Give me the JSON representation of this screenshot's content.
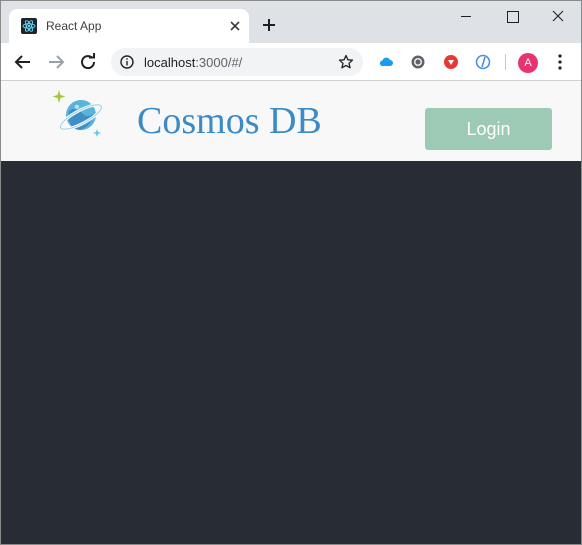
{
  "browser": {
    "tab": {
      "title": "React App"
    },
    "address": {
      "host": "localhost",
      "path": ":3000/#/"
    },
    "profile_initial": "A"
  },
  "app": {
    "brand": "Cosmos DB",
    "login_label": "Login"
  },
  "colors": {
    "header_bg": "#f8f8f8",
    "page_bg": "#282c34",
    "brand_text": "#3a8cc9",
    "login_bg": "#9ccab4",
    "avatar_bg": "#e8336e"
  },
  "icons": [
    "react-favicon-icon",
    "close-icon",
    "plus-icon",
    "back-arrow-icon",
    "forward-arrow-icon",
    "reload-icon",
    "info-icon",
    "star-icon",
    "cloud-extension-icon",
    "circle-extension-icon",
    "red-extension-icon",
    "blue-extension-icon",
    "kebab-menu-icon",
    "cosmos-planet-icon"
  ]
}
